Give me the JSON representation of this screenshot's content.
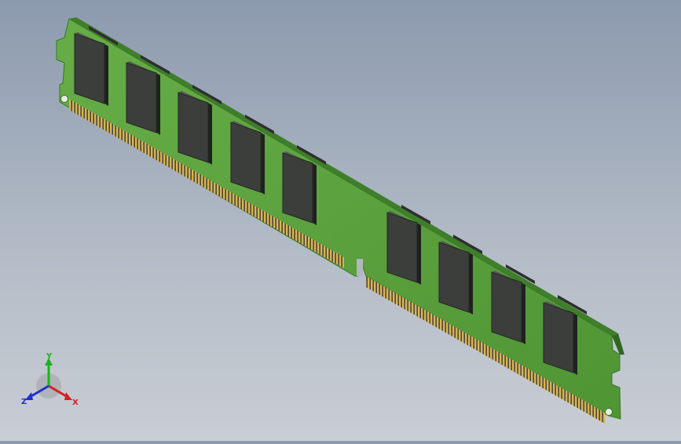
{
  "viewport": {
    "background_top": "#8c9aae",
    "background_bottom": "#c9cdd4"
  },
  "model": {
    "pcb_color": "#5aa03c",
    "pcb_edge_color": "#3d7a29",
    "chip_color": "#3b3e3b",
    "pin_color": "#c8a24a",
    "front_chip_count": 9,
    "back_chip_count": 9
  },
  "triad": {
    "x_label": "X",
    "y_label": "Y",
    "z_label": "Z",
    "x_color": "#d42020",
    "y_color": "#20b020",
    "z_color": "#2030d0"
  }
}
